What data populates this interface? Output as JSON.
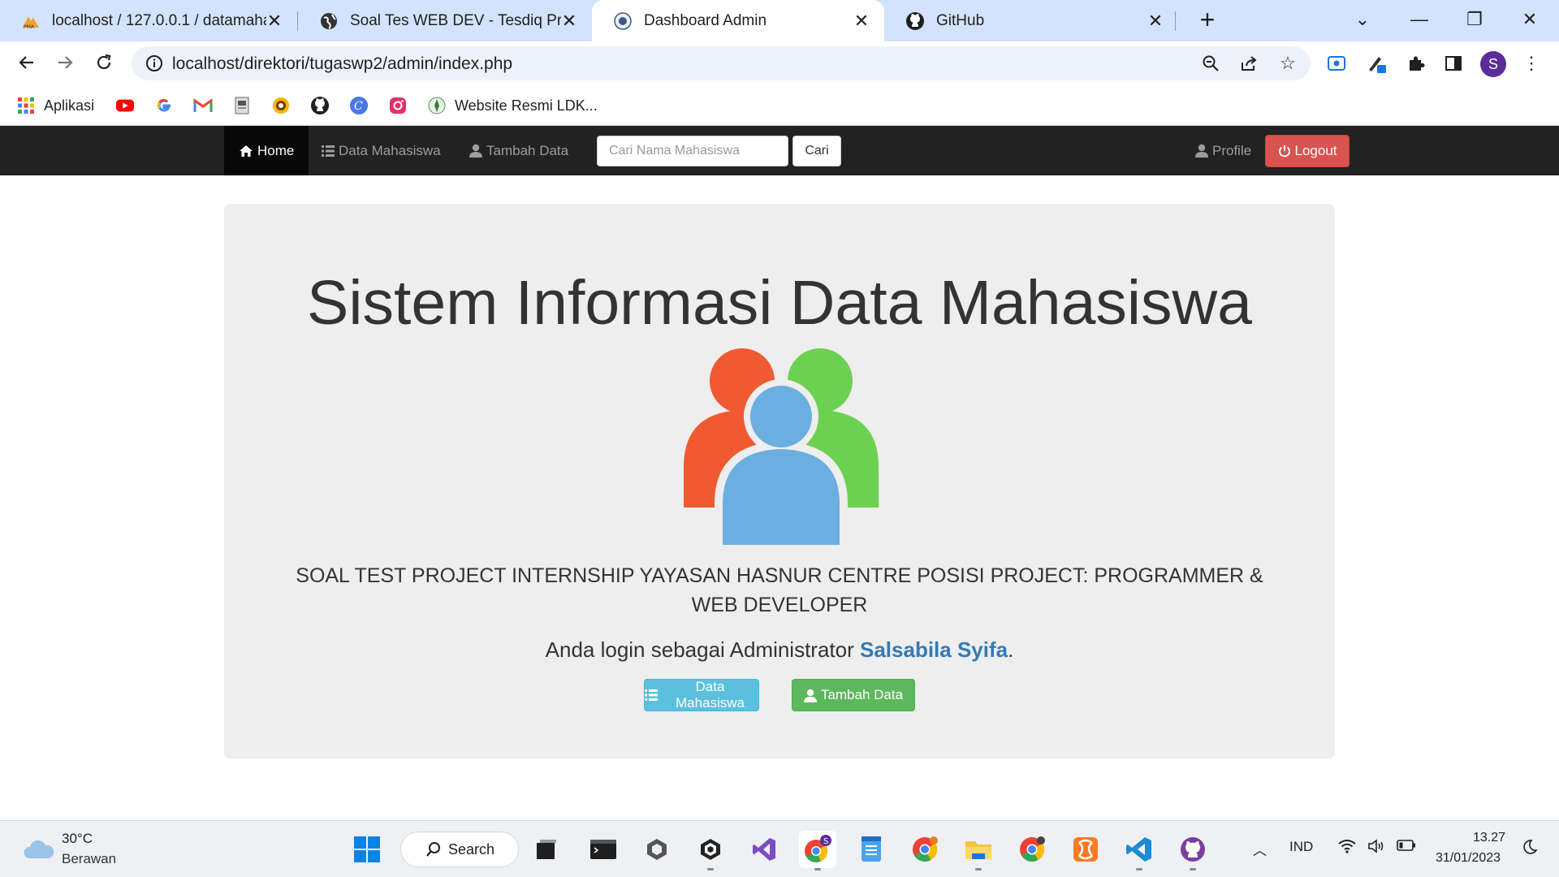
{
  "browser": {
    "tabs": [
      {
        "title": "localhost / 127.0.0.1 / datamahasiswa",
        "favicon": "phpmyadmin-icon"
      },
      {
        "title": "Soal Tes WEB DEV - Tesdiq Prigel",
        "favicon": "globe-icon"
      },
      {
        "title": "Dashboard Admin",
        "favicon": "site-logo-icon"
      },
      {
        "title": "GitHub",
        "favicon": "github-icon"
      }
    ],
    "url": "localhost/direktori/tugaswp2/admin/index.php",
    "bookmarks": {
      "apps_label": "Aplikasi",
      "website_label": "Website Resmi LDK..."
    },
    "profile_initial": "S"
  },
  "site_nav": {
    "home": "Home",
    "data_mahasiswa": "Data Mahasiswa",
    "tambah_data": "Tambah Data",
    "search_placeholder": "Cari Nama Mahasiswa",
    "search_button": "Cari",
    "profile": "Profile",
    "logout": "Logout"
  },
  "jumbotron": {
    "title": "Sistem Informasi Data Mahasiswa",
    "subtitle": "SOAL TEST PROJECT INTERNSHIP YAYASAN HASNUR CENTRE POSISI PROJECT: PROGRAMMER & WEB DEVELOPER",
    "login_prefix": "Anda login sebagai Administrator",
    "admin_name": "Salsabila Syifa",
    "login_suffix": ".",
    "btn_data": "Data Mahasiswa",
    "btn_tambah": "Tambah Data"
  },
  "taskbar": {
    "weather_temp": "30°C",
    "weather_desc": "Berawan",
    "search_label": "Search",
    "language": "IND",
    "time": "13.27",
    "date": "31/01/2023"
  },
  "colors": {
    "navbar_bg": "#222222",
    "logout": "#d9534f",
    "info": "#5bc0de",
    "success": "#5cb85c",
    "link": "#337ab7",
    "person_orange": "#f05a30",
    "person_green": "#6cd150",
    "person_blue": "#6aafe0"
  }
}
